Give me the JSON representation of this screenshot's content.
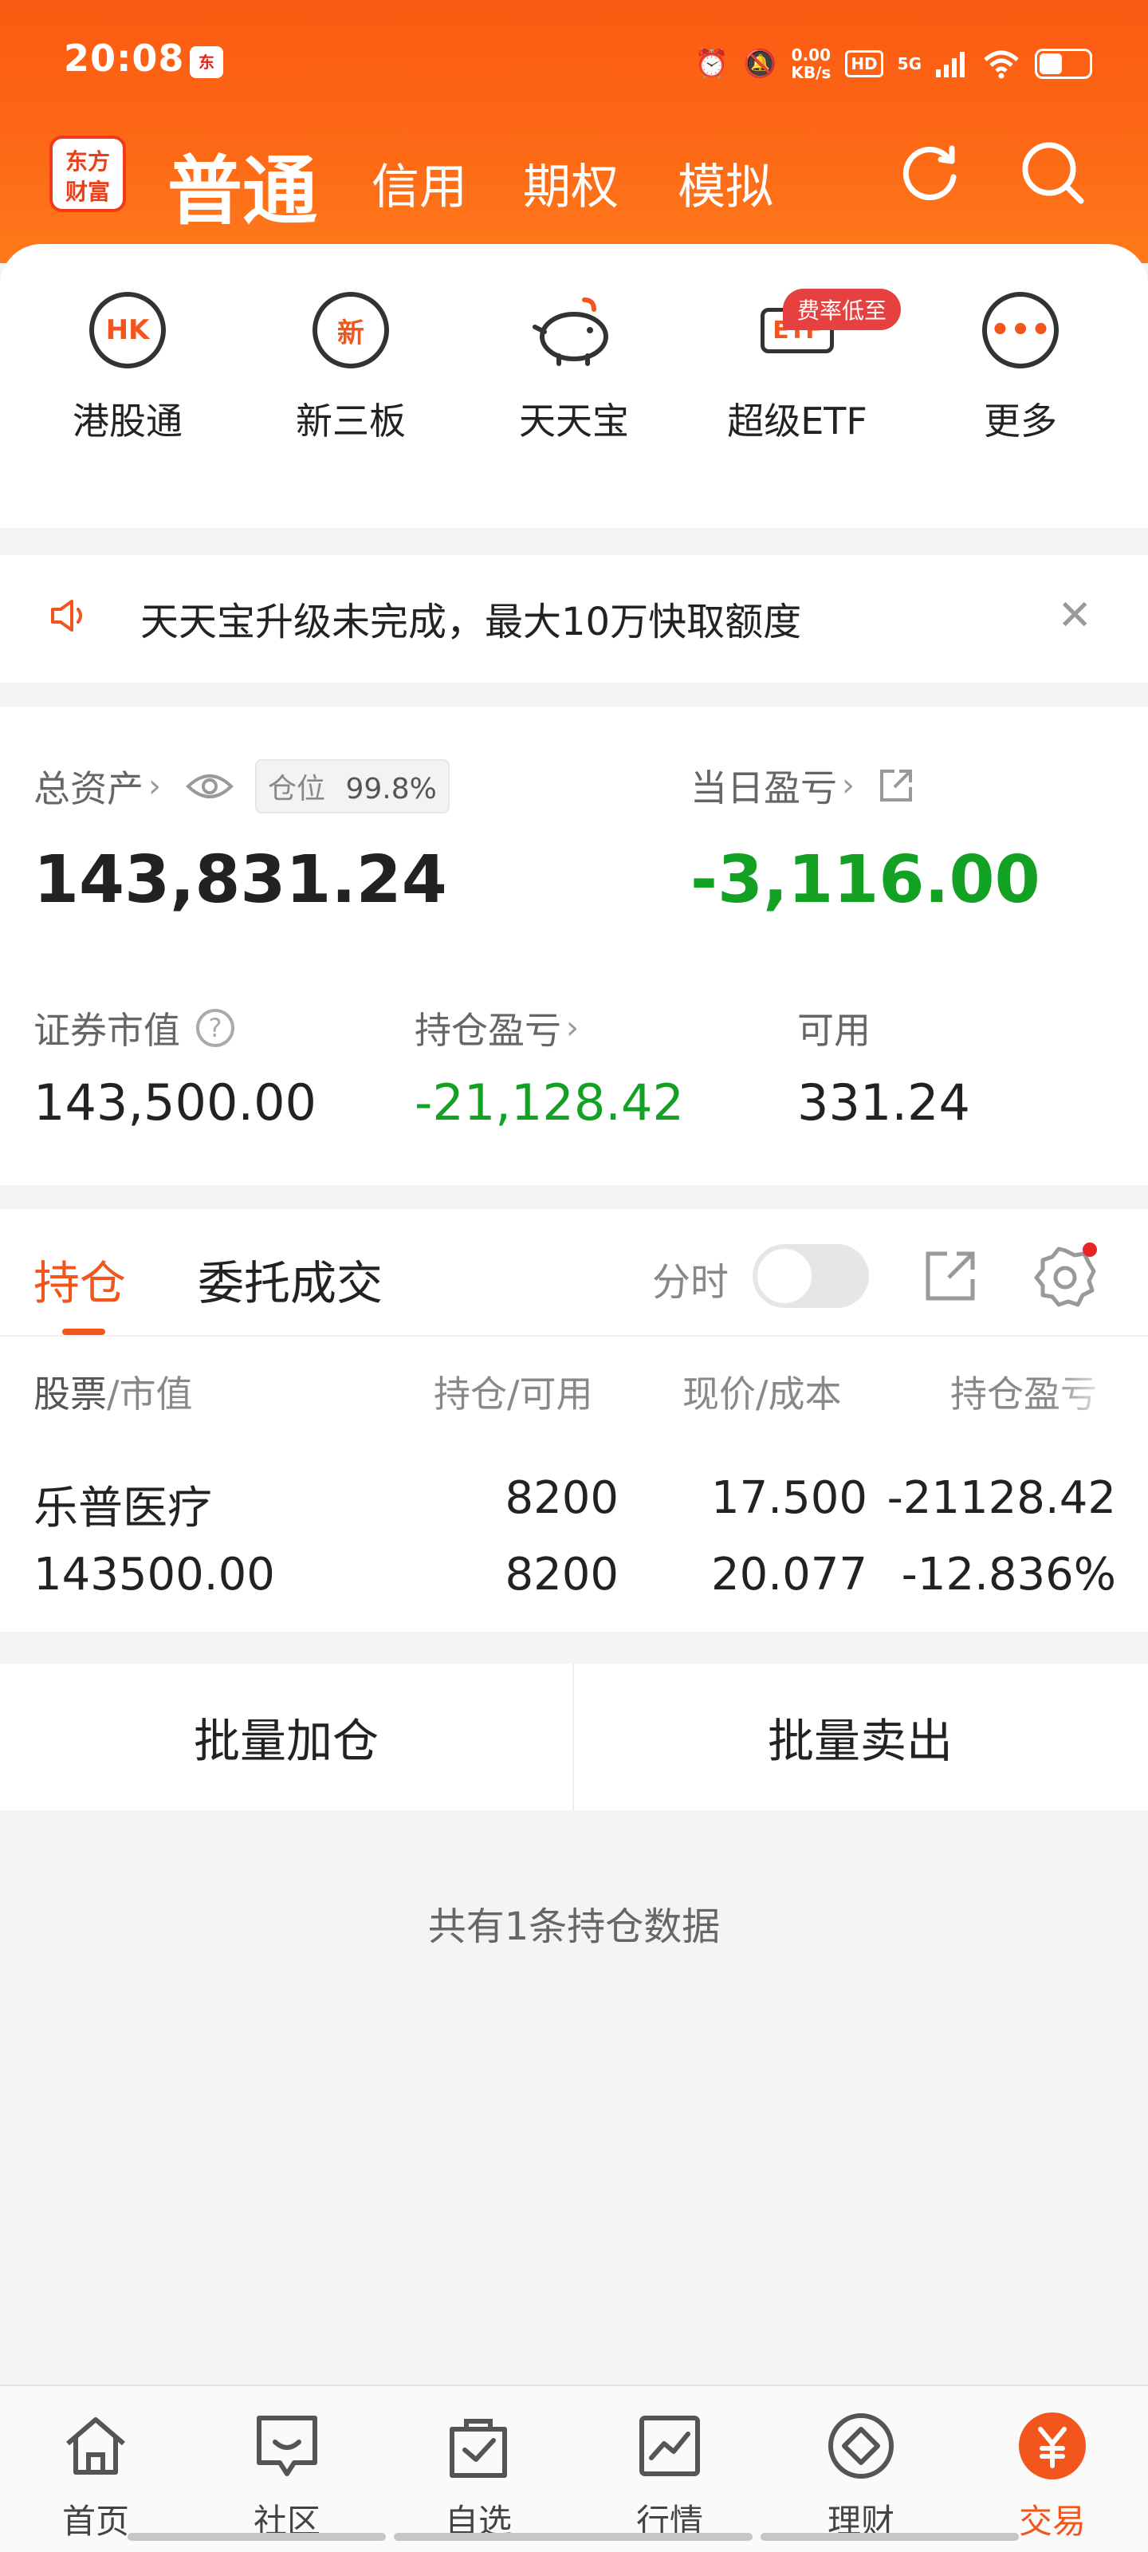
{
  "status_bar": {
    "time": "20:08",
    "net_speed_value": "0.00",
    "net_speed_unit": "KB/s",
    "hd": "HD",
    "signal": "5G"
  },
  "nav": {
    "logo_line1": "东方",
    "logo_line2": "财富",
    "tabs": [
      "普通",
      "信用",
      "期权",
      "模拟"
    ]
  },
  "quick_actions": [
    {
      "label": "港股通",
      "icon": "HK"
    },
    {
      "label": "新三板",
      "icon": "新"
    },
    {
      "label": "天天宝",
      "icon": "piggy-bank"
    },
    {
      "label": "超级ETF",
      "icon": "ETF"
    },
    {
      "label": "更多",
      "icon": "more"
    }
  ],
  "quick_badge": "费率低至",
  "notice": {
    "text": "天天宝升级未完成，最大10万快取额度"
  },
  "assets": {
    "total_label": "总资产",
    "position_ratio_label": "仓位",
    "position_ratio": "99.8%",
    "total_value": "143,831.24",
    "daily_pl_label": "当日盈亏",
    "daily_pl_value": "-3,116.00",
    "market_value_label": "证券市值",
    "market_value": "143,500.00",
    "holding_pl_label": "持仓盈亏",
    "holding_pl_value": "-21,128.42",
    "available_label": "可用",
    "available_value": "331.24"
  },
  "positions": {
    "tabs": [
      "持仓",
      "委托成交"
    ],
    "realtime_label": "分时",
    "headers": {
      "stock": "股票",
      "market_value": "/市值",
      "holding": "持仓/可用",
      "price": "现价/成本",
      "pl": "持仓盈亏"
    },
    "rows": [
      {
        "name": "乐普医疗",
        "market_value": "143500.00",
        "holding": "8200",
        "available": "8200",
        "price": "17.500",
        "cost": "20.077",
        "pl": "-21128.42",
        "pl_pct": "-12.836%"
      }
    ]
  },
  "batch": {
    "add": "批量加仓",
    "sell": "批量卖出"
  },
  "count_text": "共有1条持仓数据",
  "tabbar": [
    {
      "label": "首页",
      "icon": "home-icon"
    },
    {
      "label": "社区",
      "icon": "chat-icon"
    },
    {
      "label": "自选",
      "icon": "bag-check-icon"
    },
    {
      "label": "行情",
      "icon": "chart-icon"
    },
    {
      "label": "理财",
      "icon": "diamond-icon"
    },
    {
      "label": "交易",
      "icon": "yuan-icon"
    }
  ],
  "colors": {
    "brand": "#fb5a12",
    "accent": "#f2561c",
    "loss_green": "#13a123"
  }
}
